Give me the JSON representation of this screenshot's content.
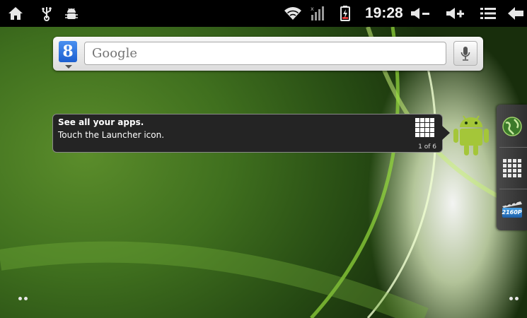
{
  "status_bar": {
    "clock": "19:28",
    "icons": [
      "home-icon",
      "usb-icon",
      "debug-icon",
      "wifi-icon",
      "signal-icon",
      "battery-charging-icon",
      "volume-down-icon",
      "volume-up-icon",
      "menu-icon",
      "back-icon"
    ]
  },
  "search": {
    "logo_letter": "8",
    "placeholder": "Google"
  },
  "tooltip": {
    "title": "See all your apps.",
    "body": "Touch the Launcher icon.",
    "count": "1 of 6"
  },
  "dock": {
    "items": [
      "browser-globe-icon",
      "launcher-grid-icon",
      "video-player-icon"
    ],
    "video_label": "2160P"
  },
  "colors": {
    "status_bar": "#000000",
    "wallpaper_green": "#3f6f1e",
    "android_green": "#a4c639"
  }
}
